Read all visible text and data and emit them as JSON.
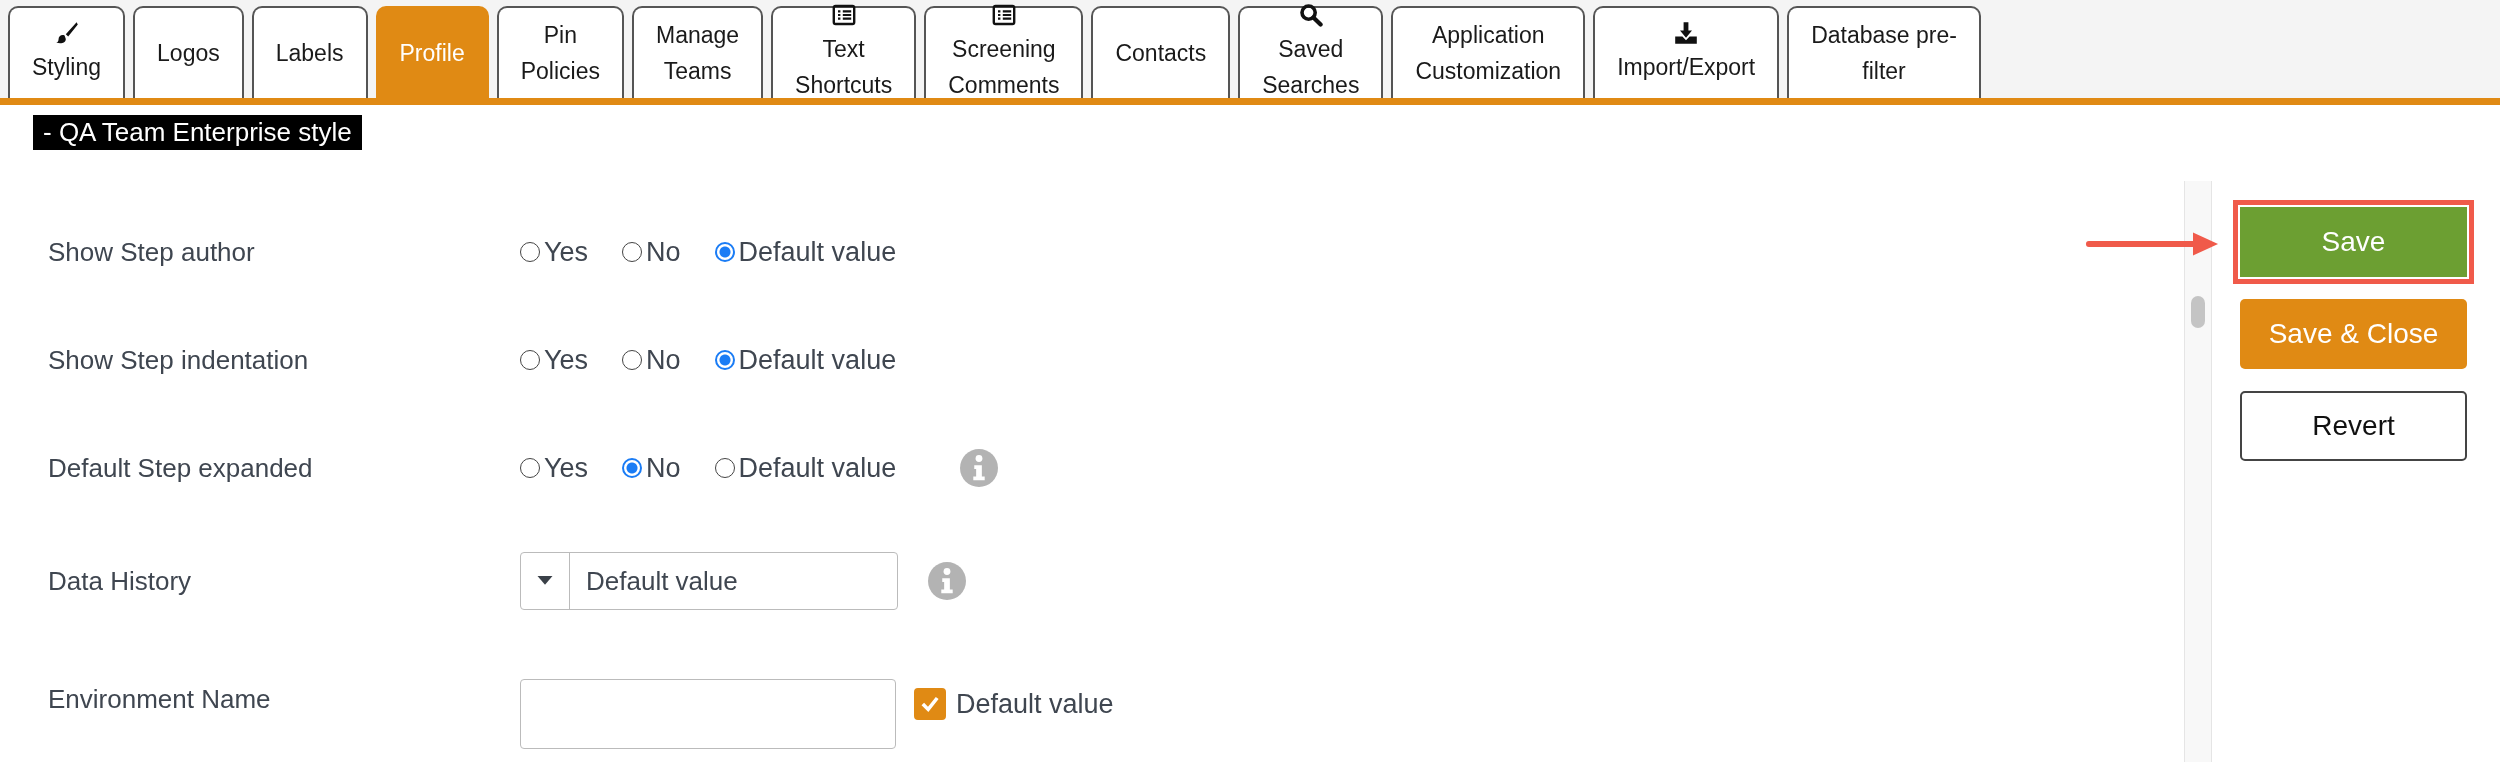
{
  "tabs": [
    {
      "kind": "brush",
      "label": "Styling",
      "selected": false
    },
    {
      "kind": "plain",
      "label": "Logos",
      "selected": false
    },
    {
      "kind": "plain",
      "label": "Labels",
      "selected": false
    },
    {
      "kind": "plain",
      "label": "Profile",
      "selected": true
    },
    {
      "kind": "plain",
      "label": "Pin\nPolicies",
      "selected": false
    },
    {
      "kind": "plain",
      "label": "Manage\nTeams",
      "selected": false
    },
    {
      "kind": "list",
      "label": "Text\nShortcuts",
      "selected": false
    },
    {
      "kind": "list",
      "label": "Screening\nComments",
      "selected": false
    },
    {
      "kind": "plain",
      "label": "Contacts",
      "selected": false
    },
    {
      "kind": "search",
      "label": "Saved\nSearches",
      "selected": false
    },
    {
      "kind": "plain",
      "label": "Application\nCustomization",
      "selected": false
    },
    {
      "kind": "download",
      "label": "Import/Export",
      "selected": false
    },
    {
      "kind": "plain",
      "label": "Database pre-\nfilter",
      "selected": false
    }
  ],
  "page_title": "- QA Team Enterprise style",
  "settings": [
    {
      "kind": "radio",
      "label": "Show Step author",
      "info": false,
      "options": [
        {
          "label": "Yes",
          "selected": false
        },
        {
          "label": "No",
          "selected": false
        },
        {
          "label": "Default value",
          "selected": true
        }
      ]
    },
    {
      "kind": "radio",
      "label": "Show Step indentation",
      "info": false,
      "options": [
        {
          "label": "Yes",
          "selected": false
        },
        {
          "label": "No",
          "selected": false
        },
        {
          "label": "Default value",
          "selected": true
        }
      ]
    },
    {
      "kind": "radio",
      "label": "Default Step expanded",
      "info": true,
      "options": [
        {
          "label": "Yes",
          "selected": false
        },
        {
          "label": "No",
          "selected": true
        },
        {
          "label": "Default value",
          "selected": false
        }
      ]
    },
    {
      "kind": "select",
      "label": "Data History",
      "info": true,
      "value": "Default value"
    },
    {
      "kind": "text",
      "label": "Environment Name",
      "info": false,
      "checkbox": {
        "label": "Default value",
        "checked": true
      }
    }
  ],
  "actions": [
    {
      "kind": "primary",
      "label": "Save",
      "highlighted": true
    },
    {
      "kind": "warning",
      "label": "Save & Close",
      "highlighted": false
    },
    {
      "kind": "plain",
      "label": "Revert",
      "highlighted": false
    }
  ]
}
